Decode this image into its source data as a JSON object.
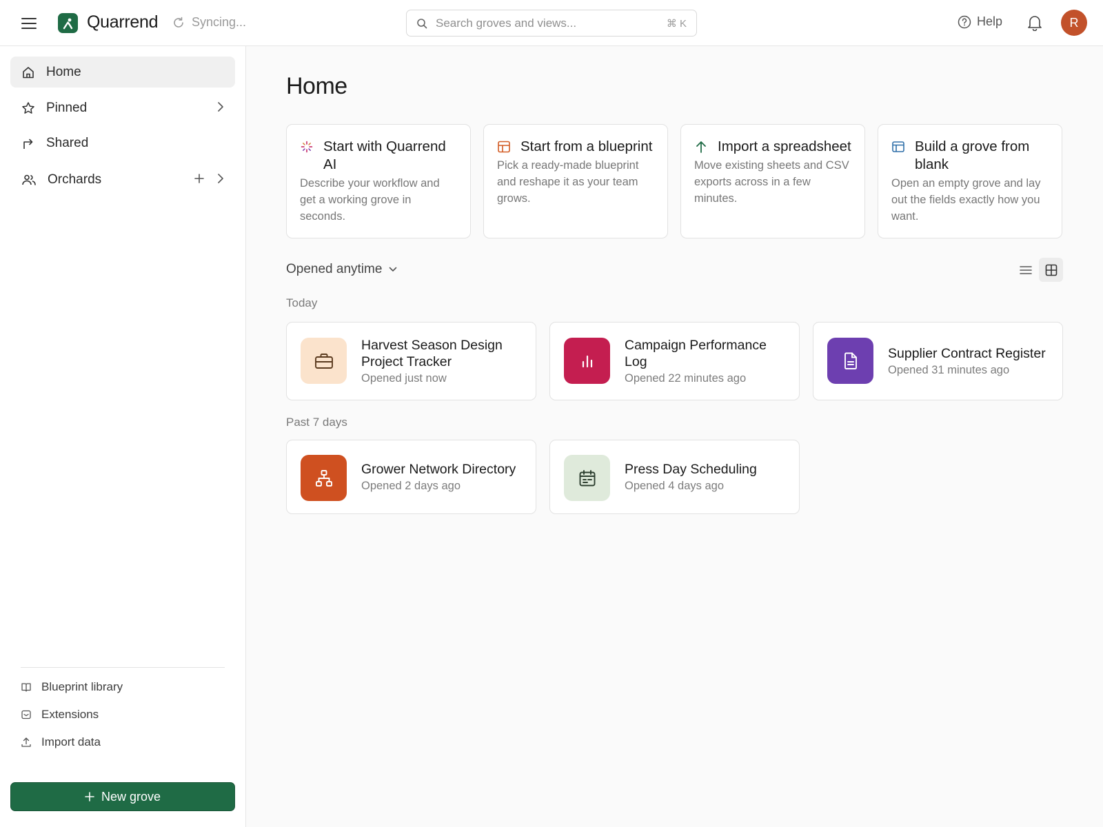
{
  "app": {
    "name": "Quarrend",
    "sync_status": "Syncing...",
    "search_placeholder": "Search groves and views...",
    "search_shortcut": "⌘ K",
    "help_label": "Help",
    "avatar_initial": "R",
    "brand_color": "#1f6b45",
    "avatar_color": "#c2512a"
  },
  "sidebar": {
    "nav": [
      {
        "label": "Home",
        "icon": "home-icon",
        "active": true
      },
      {
        "label": "Pinned",
        "icon": "star-icon"
      },
      {
        "label": "Shared",
        "icon": "share-arrow-icon"
      },
      {
        "label": "Orchards",
        "icon": "users-icon"
      }
    ],
    "footer": [
      {
        "label": "Blueprint library",
        "icon": "book-icon"
      },
      {
        "label": "Extensions",
        "icon": "extensions-icon"
      },
      {
        "label": "Import data",
        "icon": "upload-icon"
      }
    ],
    "new_button": "New grove"
  },
  "main": {
    "title": "Home",
    "start_cards": [
      {
        "title": "Start with Quarrend AI",
        "desc": "Describe your workflow and get a working grove in seconds.",
        "icon": "sparkle-icon"
      },
      {
        "title": "Start from a blueprint",
        "desc": "Pick a ready-made blueprint and reshape it as your team grows.",
        "icon": "grid-icon"
      },
      {
        "title": "Import a spreadsheet",
        "desc": "Move existing sheets and CSV exports across in a few minutes.",
        "icon": "arrow-up-icon"
      },
      {
        "title": "Build a grove from blank",
        "desc": "Open an empty grove and lay out the fields exactly how you want.",
        "icon": "layout-icon"
      }
    ],
    "filter_label": "Opened anytime",
    "sections": [
      {
        "label": "Today",
        "groves": [
          {
            "name": "Harvest Season Design Project Tracker",
            "opened": "Opened just now",
            "icon": "briefcase-icon",
            "tile_color": "#fbe3cc"
          },
          {
            "name": "Campaign Performance Log",
            "opened": "Opened 22 minutes ago",
            "icon": "bar-chart-icon",
            "tile_color": "#c41e50"
          },
          {
            "name": "Supplier Contract Register",
            "opened": "Opened 31 minutes ago",
            "icon": "document-icon",
            "tile_color": "#6d3fb0"
          }
        ]
      },
      {
        "label": "Past 7 days",
        "groves": [
          {
            "name": "Grower Network Directory",
            "opened": "Opened 2 days ago",
            "icon": "org-chart-icon",
            "tile_color": "#cf5020"
          },
          {
            "name": "Press Day Scheduling",
            "opened": "Opened 4 days ago",
            "icon": "calendar-icon",
            "tile_color": "#dfeadb"
          }
        ]
      }
    ]
  }
}
